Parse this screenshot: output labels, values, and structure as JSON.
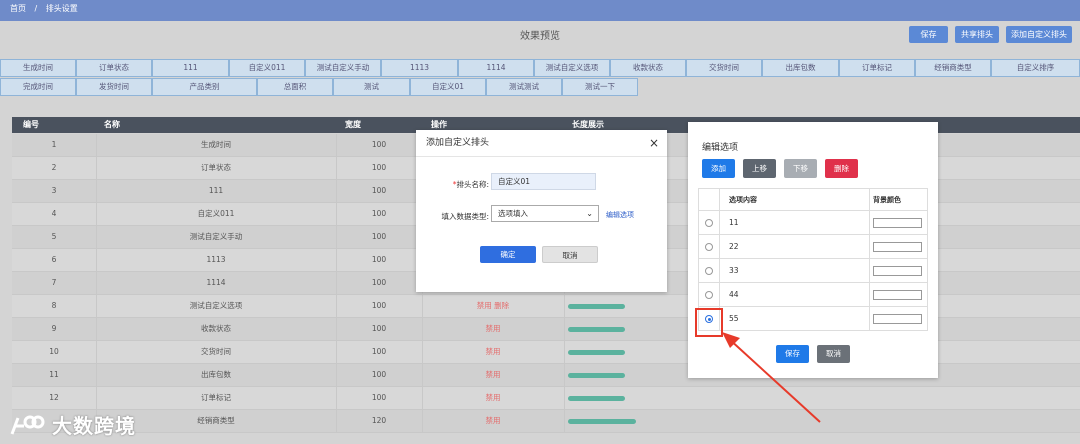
{
  "breadcrumb": {
    "home": "首页",
    "sep": "/",
    "current": "排头设置"
  },
  "preview_title": "效果预览",
  "top_buttons": {
    "save": "保存",
    "share": "共享排头",
    "add_custom": "添加自定义排头"
  },
  "chips_row1": [
    "生成时间",
    "订单状态",
    "111",
    "自定义011",
    "测试自定义手动",
    "1113",
    "1114",
    "测试自定义选项",
    "收款状态",
    "交货时间",
    "出库包数",
    "订单标记",
    "经销商类型",
    "自定义排序"
  ],
  "chips_row2": [
    "完成时间",
    "发货时间",
    "产品类别",
    "总面积",
    "测试",
    "自定义01",
    "测试测试",
    "测试一下"
  ],
  "table": {
    "headers": {
      "no": "编号",
      "name": "名称",
      "width": "宽度",
      "action": "操作",
      "length": "长度展示"
    },
    "rows": [
      {
        "no": "1",
        "name": "生成时间",
        "width": "100",
        "action": "",
        "bar": 0
      },
      {
        "no": "2",
        "name": "订单状态",
        "width": "100",
        "action": "",
        "bar": 0
      },
      {
        "no": "3",
        "name": "111",
        "width": "100",
        "action": "",
        "bar": 0
      },
      {
        "no": "4",
        "name": "自定义011",
        "width": "100",
        "action": "",
        "bar": 0
      },
      {
        "no": "5",
        "name": "测试自定义手动",
        "width": "100",
        "action": "",
        "bar": 0
      },
      {
        "no": "6",
        "name": "1113",
        "width": "100",
        "action": "",
        "bar": 0
      },
      {
        "no": "7",
        "name": "1114",
        "width": "100",
        "action": "",
        "bar": 0
      },
      {
        "no": "8",
        "name": "测试自定义选项",
        "width": "100",
        "action": "禁用 删除",
        "bar": 1
      },
      {
        "no": "9",
        "name": "收款状态",
        "width": "100",
        "action": "禁用",
        "bar": 1
      },
      {
        "no": "10",
        "name": "交货时间",
        "width": "100",
        "action": "禁用",
        "bar": 1
      },
      {
        "no": "11",
        "name": "出库包数",
        "width": "100",
        "action": "禁用",
        "bar": 1
      },
      {
        "no": "12",
        "name": "订单标记",
        "width": "100",
        "action": "禁用",
        "bar": 1
      },
      {
        "no": "",
        "name": "经销商类型",
        "width": "120",
        "action": "禁用",
        "bar": 1
      }
    ]
  },
  "add_dialog": {
    "title": "添加自定义排头",
    "close": "×",
    "name_label_required": "*",
    "name_label": "排头名称:",
    "name_value": "自定义01",
    "type_label": "填入数据类型:",
    "type_value": "选项填入",
    "edit_link": "编辑选项",
    "confirm": "确定",
    "cancel": "取消"
  },
  "options_panel": {
    "title": "编辑选项",
    "btn_add": "添加",
    "btn_up": "上移",
    "btn_down": "下移",
    "btn_delete": "删除",
    "col_content": "选项内容",
    "col_color": "背景颜色",
    "options": [
      "11",
      "22",
      "33",
      "44",
      "55"
    ],
    "selected_index": 4,
    "save": "保存",
    "cancel": "取消"
  },
  "watermark": "大数跨境",
  "colors": {
    "topbar": "#6f8bc9",
    "primary": "#2a70e0",
    "danger": "#e0314b",
    "bar": "#5bb29e",
    "highlight": "#e73a2a"
  }
}
